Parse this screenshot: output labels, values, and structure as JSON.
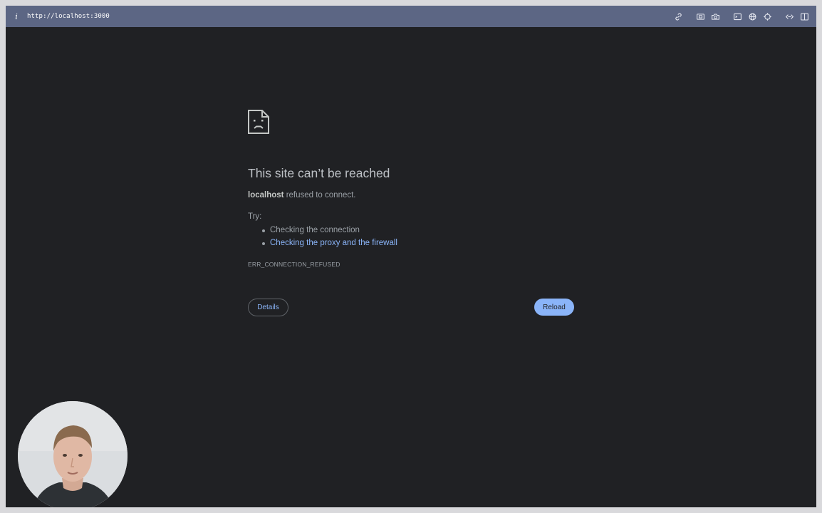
{
  "toolbar": {
    "info_icon": "i",
    "url": "http://localhost:3000",
    "tools": [
      "link-icon",
      "screenshot-area-icon",
      "camera-icon",
      "terminal-icon",
      "globe-icon",
      "crosshair-icon",
      "code-icon",
      "split-view-icon"
    ]
  },
  "error": {
    "icon": "sad-document-icon",
    "title": "This site can’t be reached",
    "host": "localhost",
    "message": "refused to connect.",
    "try_label": "Try:",
    "suggestions": [
      "Checking the connection",
      "Checking the proxy and the firewall"
    ],
    "code": "ERR_CONNECTION_REFUSED",
    "details_label": "Details",
    "reload_label": "Reload"
  },
  "colors": {
    "toolbar": "#5c6684",
    "page_bg": "#202124",
    "link": "#8ab4f8",
    "reload_button": "#8ab4f8"
  }
}
